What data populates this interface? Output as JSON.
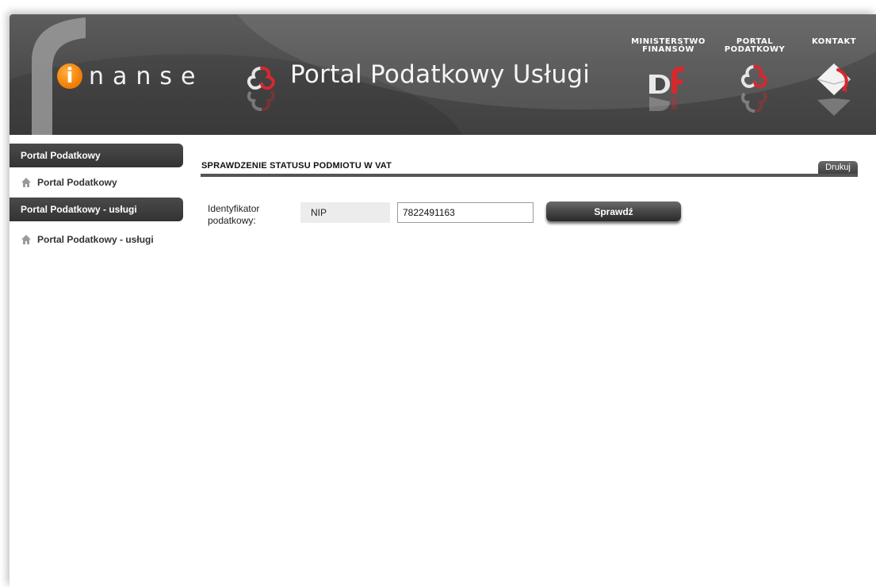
{
  "header": {
    "brand_icon_letter": "i",
    "brand_word": "nanse",
    "portal_title": "Portal Podatkowy Usługi",
    "links": {
      "ministry_line1": "MINISTERSTWO",
      "ministry_line2": "FINANSÓW",
      "portal_line1": "PORTAL",
      "portal_line2": "PODATKOWY",
      "contact": "KONTAKT"
    },
    "icons": {
      "ministry": "mf-logo-icon",
      "portal": "portal-podatkowy-logo-icon",
      "contact": "envelope-icon"
    }
  },
  "sidebar": {
    "sections": [
      {
        "heading": "Portal Podatkowy",
        "item": "Portal Podatkowy"
      },
      {
        "heading": "Portal Podatkowy - usługi",
        "item": "Portal Podatkowy - usługi"
      }
    ]
  },
  "main": {
    "title": "SPRAWDZENIE STATUSU PODMIOTU W VAT",
    "print_label": "Drukuj",
    "form": {
      "label": "Identyfikator podatkowy:",
      "id_type": "NIP",
      "id_value": "7822491163",
      "submit_label": "Sprawdź"
    }
  },
  "colors": {
    "header_bg": "#4a4a4a",
    "brand_orange": "#f07a00",
    "accent_red": "#d9272e",
    "sidebar_head_bg": "#3a3a3a"
  }
}
